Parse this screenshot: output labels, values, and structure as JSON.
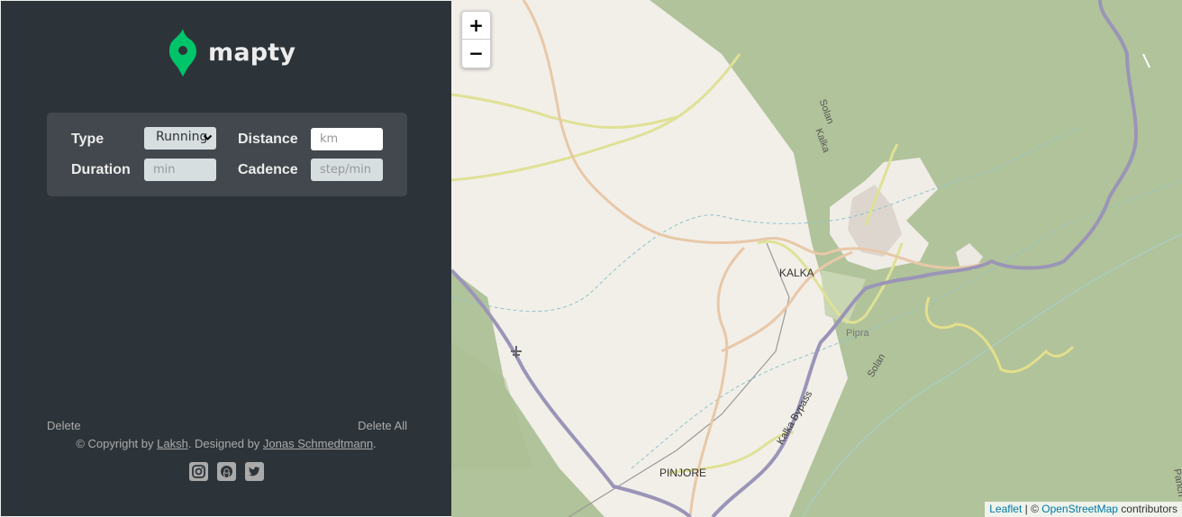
{
  "app": {
    "name": "mapty"
  },
  "form": {
    "type_label": "Type",
    "type_value": "Running",
    "distance_label": "Distance",
    "distance_placeholder": "km",
    "duration_label": "Duration",
    "duration_placeholder": "min",
    "cadence_label": "Cadence",
    "cadence_placeholder": "step/min"
  },
  "actions": {
    "delete": "Delete",
    "delete_all": "Delete All"
  },
  "footer": {
    "prefix": "© Copyright by ",
    "author": "Laksh",
    "middle": ". Designed by ",
    "designer": "Jonas Schmedtmann",
    "suffix": "."
  },
  "socials": [
    "instagram-icon",
    "github-icon",
    "twitter-icon"
  ],
  "map": {
    "zoom_in": "+",
    "zoom_out": "−",
    "labels": {
      "kalka": "KALKA",
      "pinjore": "PINJORE",
      "pipra": "Pipra",
      "solan1": "Solan",
      "kalka_small": "Kalka",
      "solan2": "Solan",
      "bypass": "Kalka Bypass",
      "panch": "Panch"
    },
    "attribution": {
      "leaflet": "Leaflet",
      "sep": " | © ",
      "osm": "OpenStreetMap",
      "suffix": " contributors"
    }
  },
  "colors": {
    "sidebar": "#2d3439",
    "form": "#42484d",
    "brand": "#00c46a",
    "forest": "#b1c39a",
    "land": "#f2efe9"
  }
}
